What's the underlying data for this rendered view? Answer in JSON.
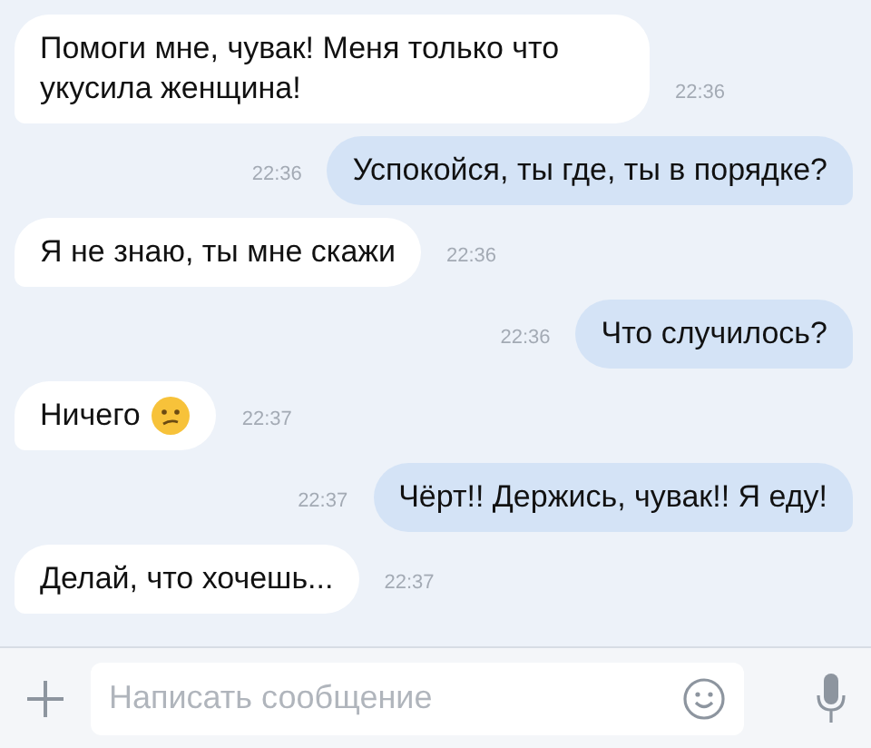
{
  "messages": [
    {
      "kind": "incoming",
      "text": "Помоги мне, чувак! Меня только что укусила женщина!",
      "time": "22:36"
    },
    {
      "kind": "outgoing",
      "text": "Успокойся, ты где, ты в порядке?",
      "time": "22:36"
    },
    {
      "kind": "incoming",
      "text": "Я не знаю, ты мне скажи",
      "time": "22:36"
    },
    {
      "kind": "outgoing",
      "text": "Что случилось?",
      "time": "22:36"
    },
    {
      "kind": "incoming",
      "text": "Ничего",
      "time": "22:37",
      "emoji": true
    },
    {
      "kind": "outgoing",
      "text": "Чёрт!! Держись, чувак!! Я еду!",
      "time": "22:37"
    },
    {
      "kind": "incoming",
      "text": "Делай, что хочешь...",
      "time": "22:37"
    }
  ],
  "composer": {
    "placeholder": "Написать сообщение"
  }
}
